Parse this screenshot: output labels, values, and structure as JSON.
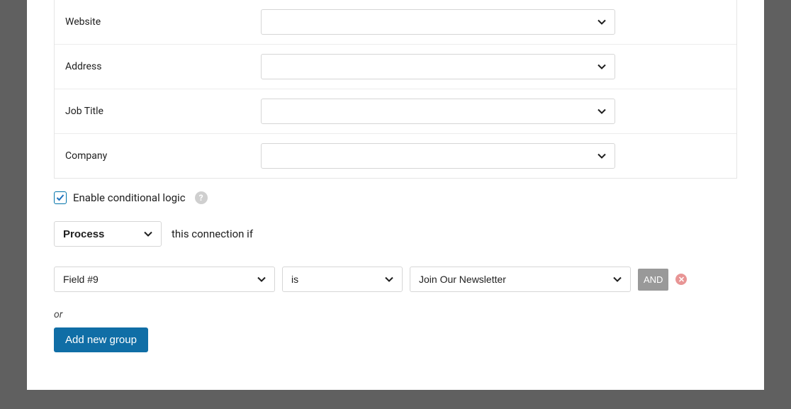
{
  "fields": [
    {
      "label": "Website",
      "value": ""
    },
    {
      "label": "Address",
      "value": ""
    },
    {
      "label": "Job Title",
      "value": ""
    },
    {
      "label": "Company",
      "value": ""
    }
  ],
  "conditional": {
    "enable_label": "Enable conditional logic",
    "enabled": true,
    "process_value": "Process",
    "connection_text": "this connection if",
    "rule": {
      "field": "Field #9",
      "operator": "is",
      "value": "Join Our Newsletter"
    },
    "and_label": "AND",
    "or_label": "or",
    "add_group_label": "Add new group"
  }
}
